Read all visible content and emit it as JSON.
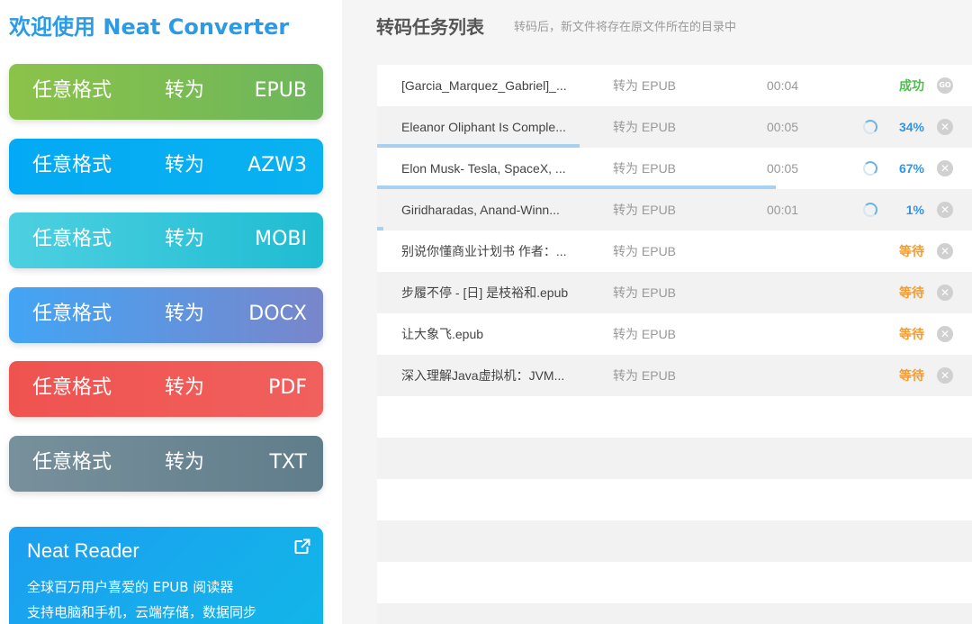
{
  "app": {
    "title": "欢迎使用 Neat Converter"
  },
  "sidebar": {
    "buttons": [
      {
        "any": "任意格式",
        "to": "转为",
        "format": "EPUB"
      },
      {
        "any": "任意格式",
        "to": "转为",
        "format": "AZW3"
      },
      {
        "any": "任意格式",
        "to": "转为",
        "format": "MOBI"
      },
      {
        "any": "任意格式",
        "to": "转为",
        "format": "DOCX"
      },
      {
        "any": "任意格式",
        "to": "转为",
        "format": "PDF"
      },
      {
        "any": "任意格式",
        "to": "转为",
        "format": "TXT"
      }
    ],
    "reader": {
      "title": "Neat Reader",
      "line1": "全球百万用户喜爱的 EPUB 阅读器",
      "line2": "支持电脑和手机，云端存储，数据同步"
    }
  },
  "main": {
    "title": "转码任务列表",
    "subtitle": "转码后，新文件将存在原文件所在的目录中",
    "tasks": [
      {
        "file": "[Garcia_Marquez_Gabriel]_...",
        "target": "转为 EPUB",
        "time": "00:04",
        "status": "成功",
        "state": "success",
        "action_icon": "go-icon",
        "action_text": "GO"
      },
      {
        "file": "Eleanor Oliphant Is Comple...",
        "target": "转为 EPUB",
        "time": "00:05",
        "status": "34%",
        "state": "progress",
        "progress": 0.34,
        "action_icon": "close-icon"
      },
      {
        "file": "Elon Musk- Tesla, SpaceX, ...",
        "target": "转为 EPUB",
        "time": "00:05",
        "status": "67%",
        "state": "progress",
        "progress": 0.67,
        "action_icon": "close-icon"
      },
      {
        "file": "Giridharadas, Anand-Winn...",
        "target": "转为 EPUB",
        "time": "00:01",
        "status": "1%",
        "state": "progress",
        "progress": 0.01,
        "action_icon": "close-icon"
      },
      {
        "file": "别说你懂商业计划书 作者：...",
        "target": "转为 EPUB",
        "time": "",
        "status": "等待",
        "state": "waiting",
        "action_icon": "close-icon"
      },
      {
        "file": "步履不停 - [日] 是枝裕和.epub",
        "target": "转为 EPUB",
        "time": "",
        "status": "等待",
        "state": "waiting",
        "action_icon": "close-icon"
      },
      {
        "file": "让大象飞.epub",
        "target": "转为 EPUB",
        "time": "",
        "status": "等待",
        "state": "waiting",
        "action_icon": "close-icon"
      },
      {
        "file": "深入理解Java虚拟机：JVM...",
        "target": "转为 EPUB",
        "time": "",
        "status": "等待",
        "state": "waiting",
        "action_icon": "close-icon"
      }
    ],
    "empty_rows": 6
  },
  "colors": {
    "title": "#2b9be6",
    "btn_epub": [
      "#8bc34a",
      "#6db65b"
    ],
    "btn_azw3": [
      "#03a9f4",
      "#0ab2f0"
    ],
    "btn_mobi": [
      "#4dd0e1",
      "#1fbcd2"
    ],
    "btn_docx": [
      "#42a5f5",
      "#7986cb"
    ],
    "btn_pdf": [
      "#ef5350",
      "#f0605d"
    ],
    "btn_txt": [
      "#78909c",
      "#607d8b"
    ]
  }
}
